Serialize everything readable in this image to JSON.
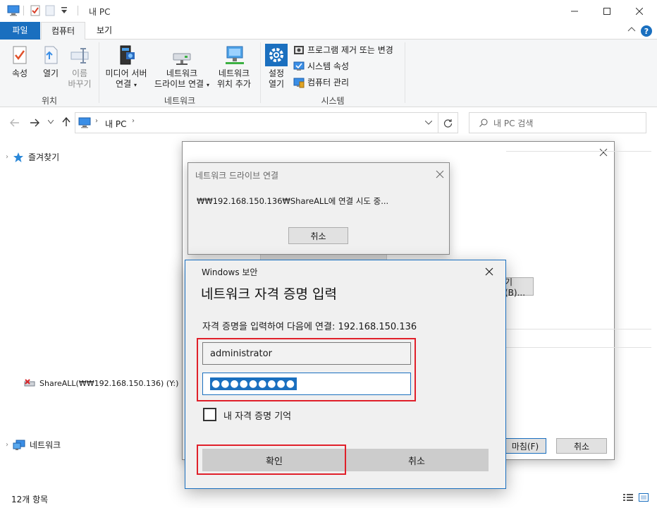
{
  "window": {
    "title": "내 PC"
  },
  "ribbon": {
    "tabs": {
      "file": "파일",
      "computer": "컴퓨터",
      "view": "보기"
    },
    "location_group": {
      "label": "위치",
      "properties": "속성",
      "open": "열기",
      "rename_line1": "이름",
      "rename_line2": "바꾸기"
    },
    "network_group": {
      "label": "네트워크",
      "media_line1": "미디어 서버",
      "media_line2": "연결",
      "map_drive_line1": "네트워크",
      "map_drive_line2": "드라이브 연결",
      "add_location_line1": "네트워크",
      "add_location_line2": "위치 추가"
    },
    "system_group": {
      "label": "시스템",
      "settings_line1": "설정",
      "settings_line2": "열기",
      "uninstall": "프로그램 제거 또는 변경",
      "system_properties": "시스템 속성",
      "manage": "컴퓨터 관리"
    }
  },
  "address": {
    "path_root": "내 PC",
    "search_placeholder": "내 PC 검색"
  },
  "nav": {
    "favorites": "즐겨찾기",
    "network": "네트워크",
    "drive": "ShareALL(₩₩192.168.150.136) (Y:)"
  },
  "status": {
    "item_count": "12개 항목"
  },
  "background_dialog": {
    "browse_button": "기(B)...",
    "finish_button": "마침(F)",
    "cancel_button": "취소"
  },
  "connect_dialog": {
    "title": "네트워크 드라이브 연결",
    "message": "₩₩192.168.150.136₩ShareALL에 연결 시도 중...",
    "cancel_button": "취소"
  },
  "security_dialog": {
    "title": "Windows 보안",
    "heading": "네트워크 자격 증명 입력",
    "prompt": "자격 증명을 입력하여 다음에 연결: 192.168.150.136",
    "username_value": "administrator",
    "password_value": "●●●●●●●●●",
    "remember_label": "내 자격 증명 기억",
    "ok_button": "확인",
    "cancel_button": "취소"
  },
  "colors": {
    "accent": "#1a6fbf",
    "highlight": "#e0202a",
    "selection": "#1a6fbf"
  }
}
